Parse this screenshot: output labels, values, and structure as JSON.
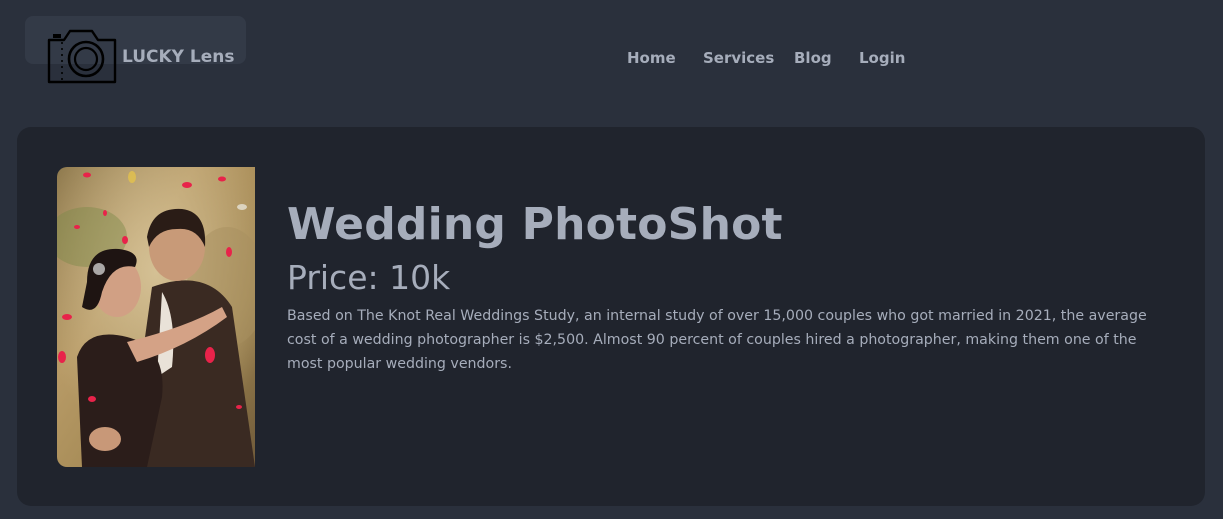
{
  "brand": {
    "name": "LUCKY Lens",
    "logo_icon": "camera-icon"
  },
  "nav": {
    "items": [
      {
        "label": "Home"
      },
      {
        "label": "Services"
      },
      {
        "label": "Blog"
      },
      {
        "label": "Login"
      }
    ]
  },
  "card": {
    "image_subject": "wedding couple embracing with falling rose petals",
    "title": "Wedding PhotoShot",
    "price": "Price: 10k",
    "description": "Based on The Knot Real Weddings Study, an internal study of over 15,000 couples who got married in 2021, the average cost of a wedding photographer is $2,500. Almost 90 percent of couples hired a photographer, making them one of the most popular wedding vendors."
  },
  "colors": {
    "page_background": "#2a303c",
    "card_background": "#20242d",
    "text": "#a6adbb",
    "petal": "#e8234a"
  }
}
